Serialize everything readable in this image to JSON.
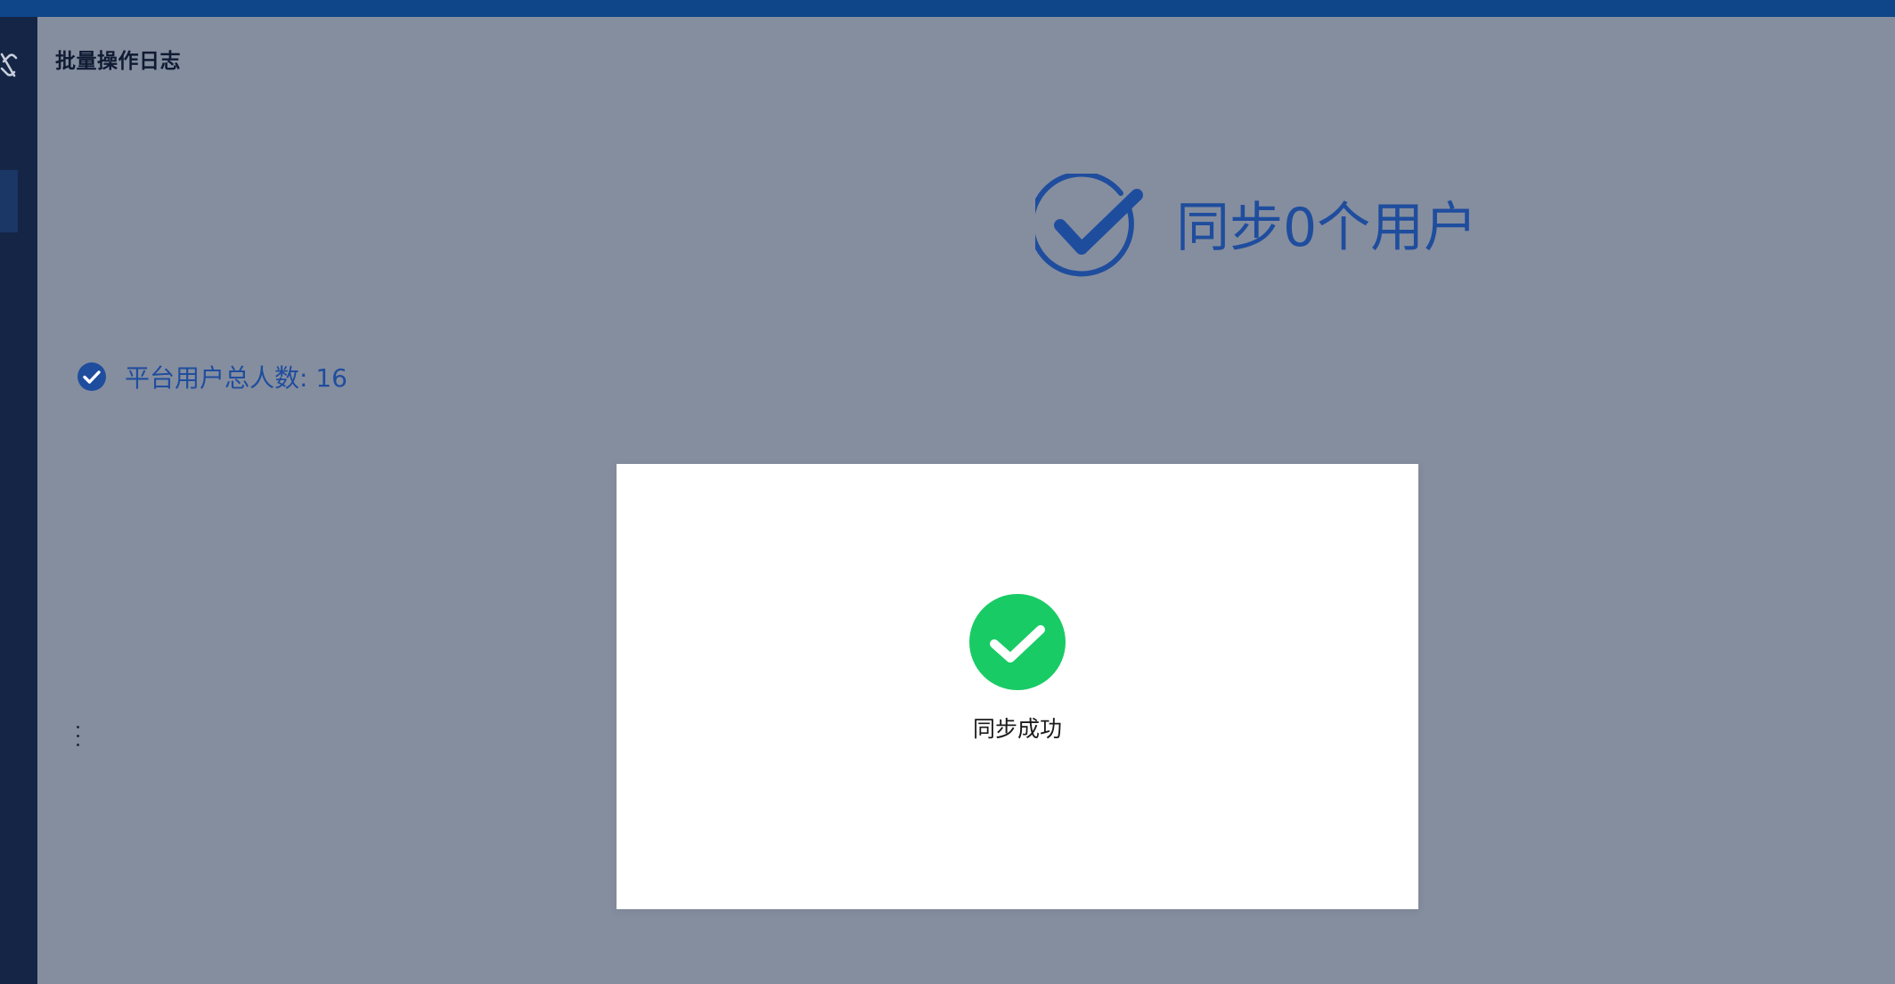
{
  "page": {
    "title": "批量操作日志"
  },
  "result": {
    "title": "同步0个用户",
    "icon": "circle-check-icon"
  },
  "stats": {
    "total_users_label": "平台用户总人数: 16",
    "icon": "check-badge-icon"
  },
  "modal": {
    "message": "同步成功",
    "icon": "success-check-icon"
  },
  "colors": {
    "topbar": "#0e4689",
    "sidebar": "#152545",
    "accent": "#1f4d9e",
    "success": "#19cb65",
    "overlay": "#858e9f"
  }
}
